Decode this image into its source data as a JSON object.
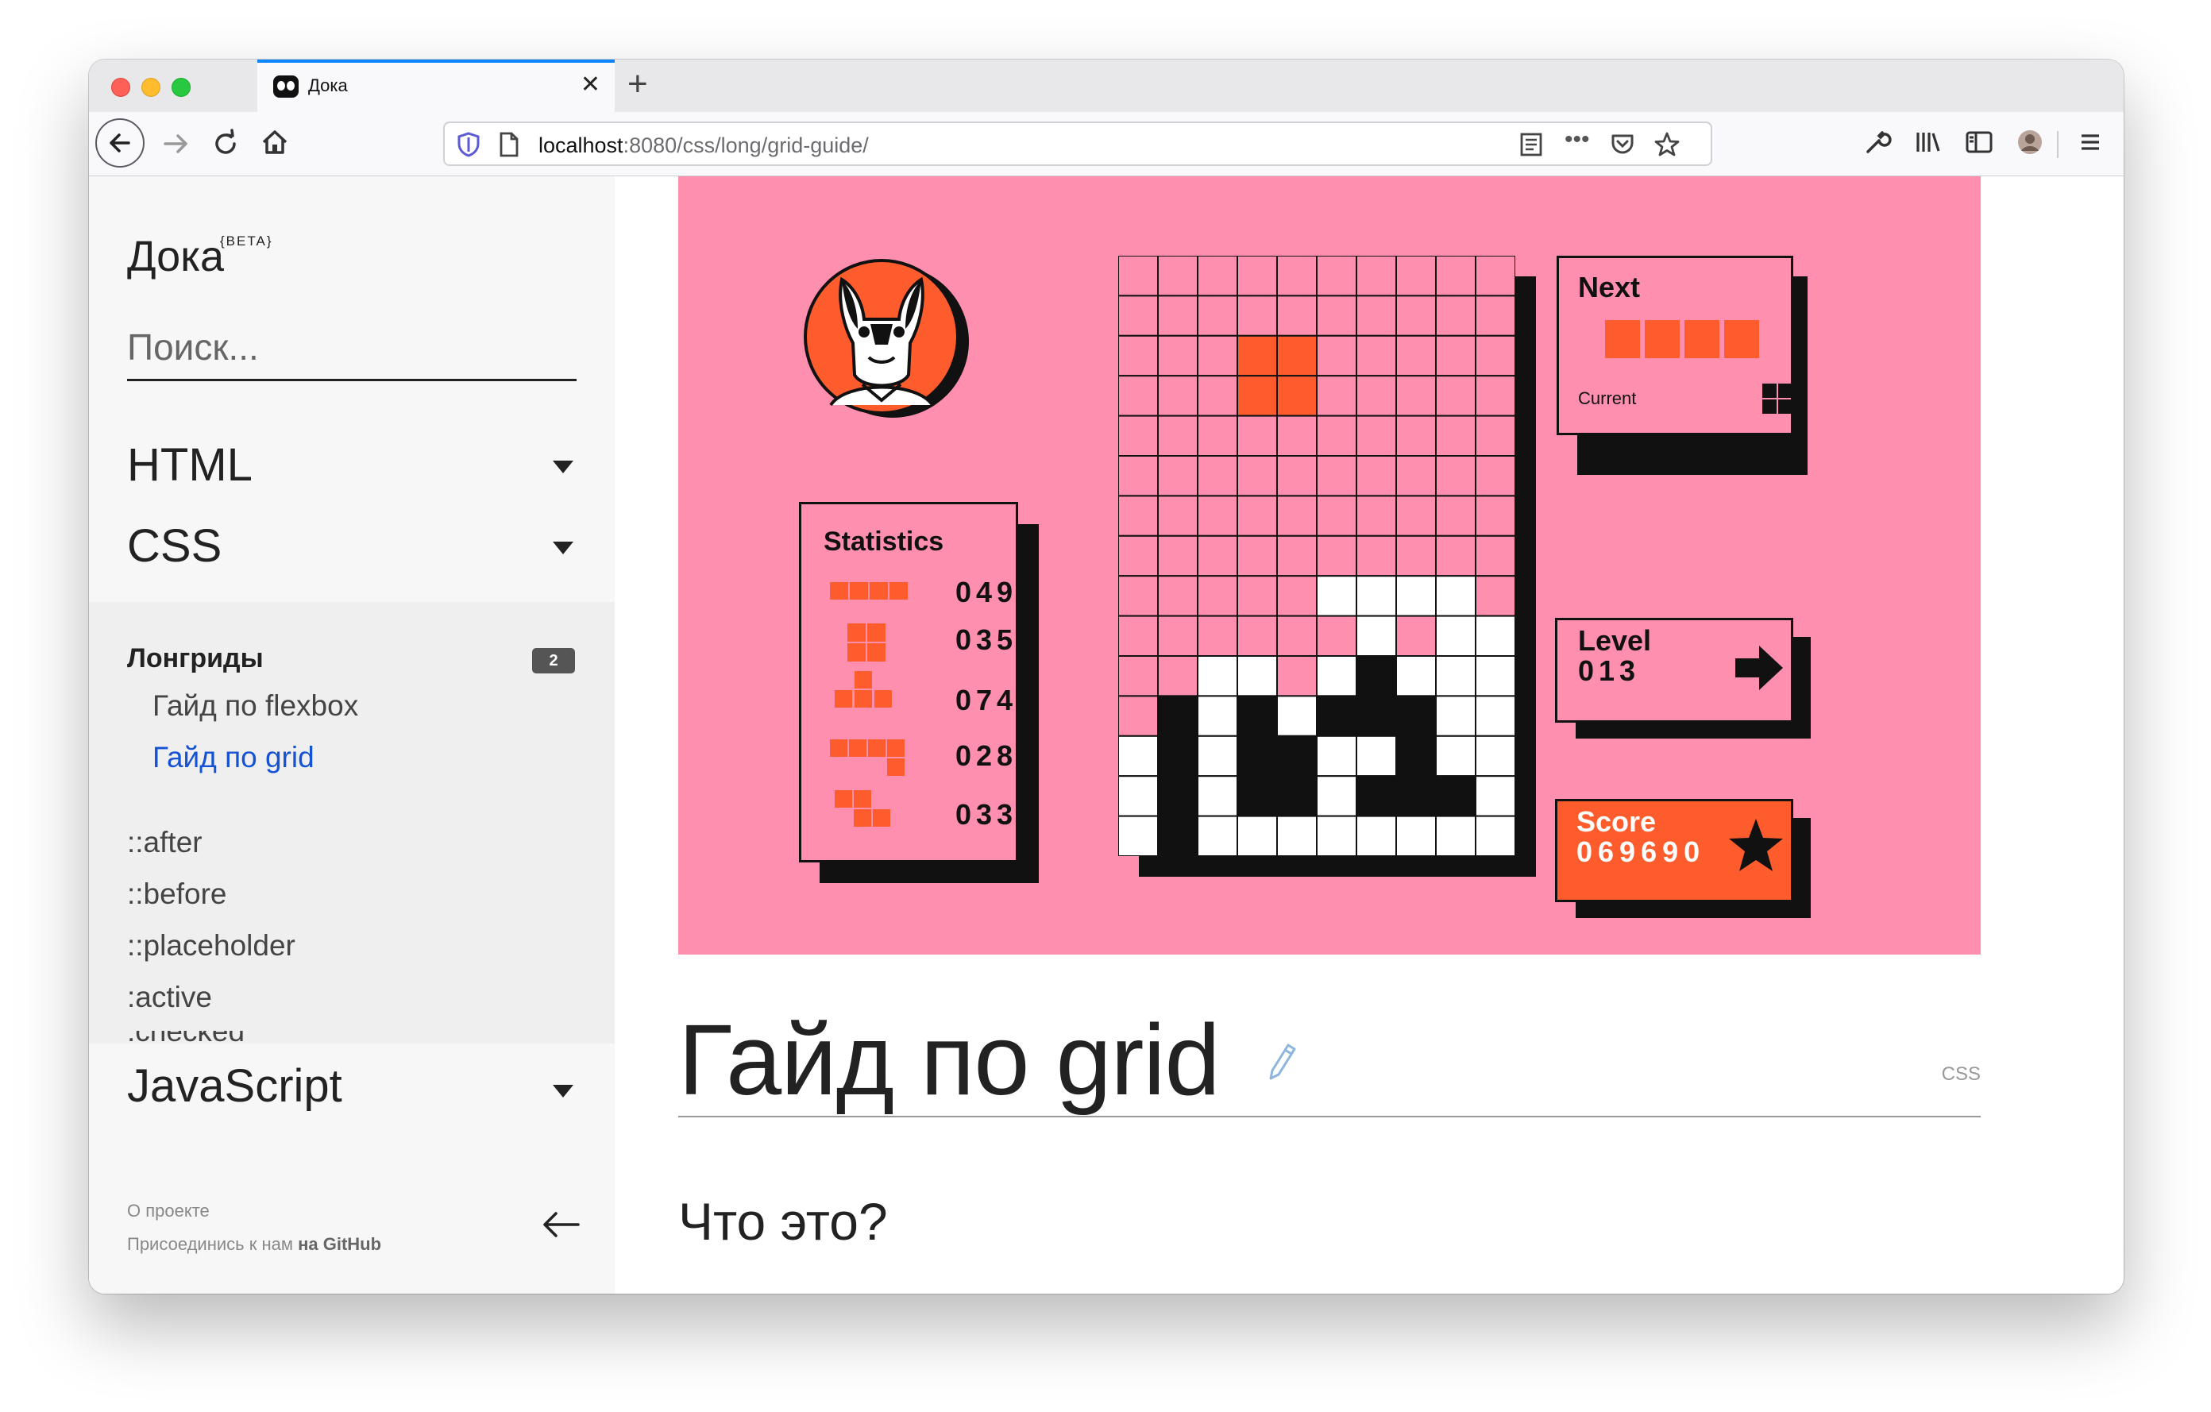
{
  "browser": {
    "tab_title": "Дока",
    "url_host": "localhost",
    "url_rest": ":8080/css/long/grid-guide/"
  },
  "sidebar": {
    "logo": "Дока",
    "beta": "{BETA}",
    "search_placeholder": "Поиск...",
    "sections": [
      {
        "label": "HTML"
      },
      {
        "label": "CSS"
      },
      {
        "label": "JavaScript"
      }
    ],
    "longreads": {
      "label": "Лонгриды",
      "count": "2",
      "items": [
        {
          "label": "Гайд по flexbox"
        },
        {
          "label": "Гайд по grid"
        }
      ]
    },
    "css_items": [
      "::after",
      "::before",
      "::placeholder",
      ":active",
      ":checked"
    ],
    "footer": {
      "about": "О проекте",
      "join_prefix": "Присоединись к нам",
      "join_link": "на GitHub"
    }
  },
  "hero": {
    "statistics_title": "Statistics",
    "stats": [
      "049",
      "035",
      "074",
      "028",
      "033"
    ],
    "next_label": "Next",
    "current_label": "Current",
    "level_label": "Level",
    "level_value": "013",
    "score_label": "Score",
    "score_value": "069690",
    "colors": {
      "background": "#ff8fae",
      "accent": "#ff5c2e",
      "ink": "#111111",
      "white": "#ffffff"
    }
  },
  "article": {
    "title": "Гайд по grid",
    "tag": "CSS",
    "h2": "Что это?"
  }
}
